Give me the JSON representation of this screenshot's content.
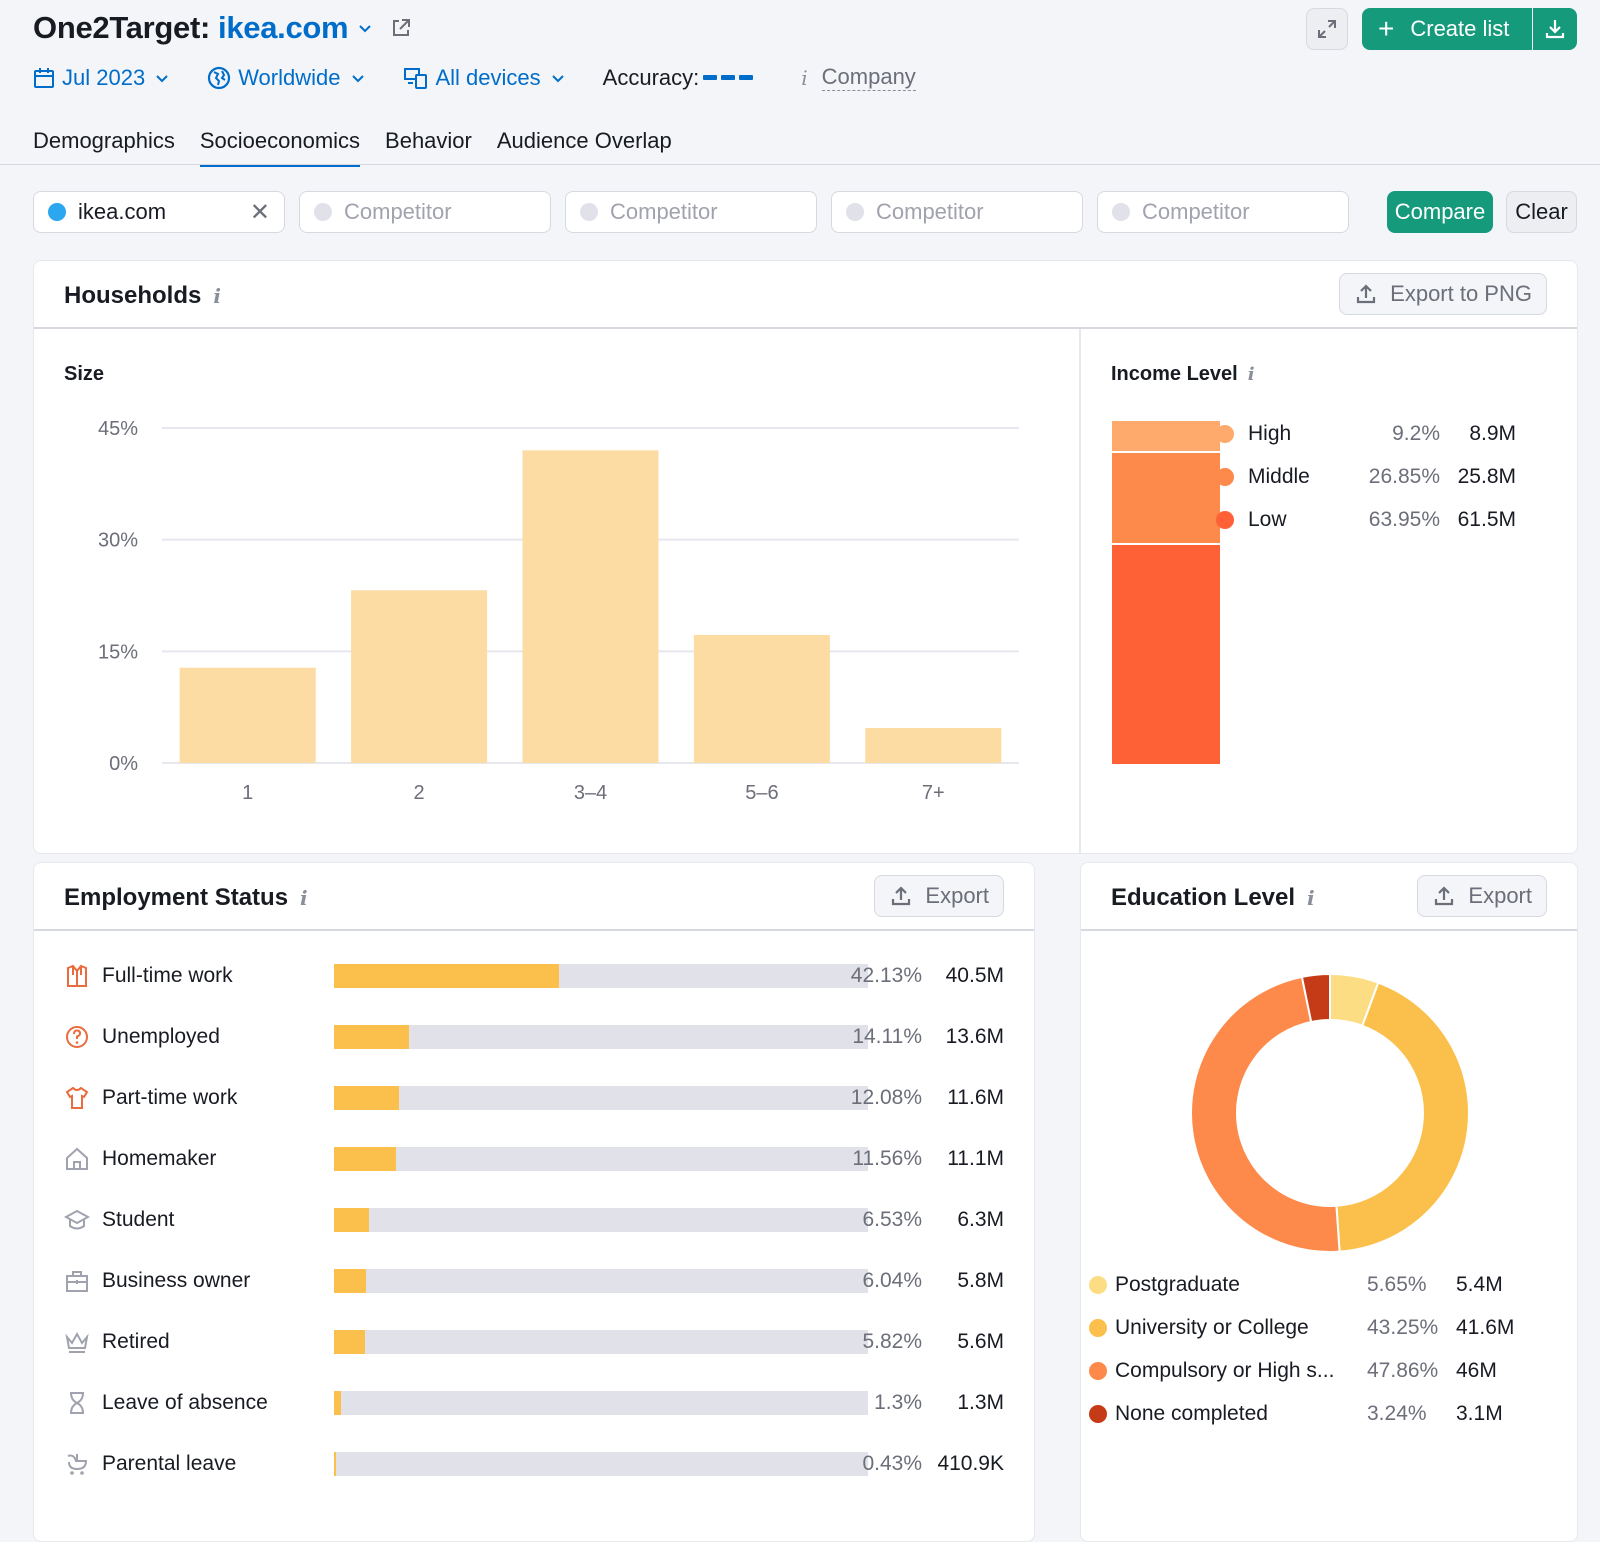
{
  "header": {
    "tool_name": "One2Target:",
    "domain": "ikea.com",
    "filters": {
      "date": "Jul 2023",
      "region": "Worldwide",
      "devices": "All devices",
      "accuracy_label": "Accuracy:",
      "company_label": "Company"
    },
    "create_list_label": "Create list"
  },
  "tabs": [
    {
      "label": "Demographics",
      "active": false
    },
    {
      "label": "Socioeconomics",
      "active": true
    },
    {
      "label": "Behavior",
      "active": false
    },
    {
      "label": "Audience Overlap",
      "active": false
    }
  ],
  "competitors": {
    "main_domain": "ikea.com",
    "placeholder": "Competitor",
    "compare_label": "Compare",
    "clear_label": "Clear"
  },
  "households": {
    "title": "Households",
    "export_label": "Export to PNG",
    "size_title": "Size",
    "income_title": "Income Level",
    "income": [
      {
        "label": "High",
        "pct": "9.2%",
        "value": "8.9M",
        "share": 9.2,
        "color": "#fdaa6c"
      },
      {
        "label": "Middle",
        "pct": "26.85%",
        "value": "25.8M",
        "share": 26.85,
        "color": "#fd8a4a"
      },
      {
        "label": "Low",
        "pct": "63.95%",
        "value": "61.5M",
        "share": 63.95,
        "color": "#ff6136"
      }
    ]
  },
  "employment": {
    "title": "Employment Status",
    "export_label": "Export",
    "rows": [
      {
        "label": "Full-time work",
        "pct": "42.13%",
        "value": "40.5M",
        "share": 42.13,
        "icon": "shirt-tie-icon"
      },
      {
        "label": "Unemployed",
        "pct": "14.11%",
        "value": "13.6M",
        "share": 14.11,
        "icon": "question-circle-icon"
      },
      {
        "label": "Part-time work",
        "pct": "12.08%",
        "value": "11.6M",
        "share": 12.08,
        "icon": "tshirt-icon"
      },
      {
        "label": "Homemaker",
        "pct": "11.56%",
        "value": "11.1M",
        "share": 11.56,
        "icon": "house-icon"
      },
      {
        "label": "Student",
        "pct": "6.53%",
        "value": "6.3M",
        "share": 6.53,
        "icon": "graduation-cap-icon"
      },
      {
        "label": "Business owner",
        "pct": "6.04%",
        "value": "5.8M",
        "share": 6.04,
        "icon": "briefcase-icon"
      },
      {
        "label": "Retired",
        "pct": "5.82%",
        "value": "5.6M",
        "share": 5.82,
        "icon": "crown-icon"
      },
      {
        "label": "Leave of absence",
        "pct": "1.3%",
        "value": "1.3M",
        "share": 1.3,
        "icon": "hourglass-icon"
      },
      {
        "label": "Parental leave",
        "pct": "0.43%",
        "value": "410.9K",
        "share": 0.43,
        "icon": "stroller-icon"
      }
    ]
  },
  "education": {
    "title": "Education Level",
    "export_label": "Export",
    "rows": [
      {
        "label": "Postgraduate",
        "pct": "5.65%",
        "value": "5.4M",
        "share": 5.65,
        "color": "#fcdd84"
      },
      {
        "label": "University or College",
        "pct": "43.25%",
        "value": "41.6M",
        "share": 43.25,
        "color": "#fbbf4b"
      },
      {
        "label": "Compulsory or High s...",
        "pct": "47.86%",
        "value": "46M",
        "share": 47.86,
        "color": "#fd8a4a"
      },
      {
        "label": "None completed",
        "pct": "3.24%",
        "value": "3.1M",
        "share": 3.24,
        "color": "#c53b17"
      }
    ]
  },
  "chart_data": [
    {
      "type": "bar",
      "title": "Size",
      "categories": [
        "1",
        "2",
        "3–4",
        "5–6",
        "7+"
      ],
      "values": [
        12.8,
        23.2,
        42.0,
        17.2,
        4.7
      ],
      "ylim": [
        0,
        45
      ],
      "yticks": [
        "0%",
        "15%",
        "30%",
        "45%"
      ],
      "ytick_values": [
        0,
        15,
        30,
        45
      ],
      "xlabel": "",
      "ylabel": "",
      "grid": true,
      "color": "#fcdca3"
    },
    {
      "type": "bar",
      "title": "Income Level",
      "stacked": true,
      "categories": [
        "High",
        "Middle",
        "Low"
      ],
      "values": [
        9.2,
        26.85,
        63.95
      ],
      "legend": "right"
    },
    {
      "type": "bar",
      "title": "Employment Status",
      "orientation": "horizontal",
      "categories": [
        "Full-time work",
        "Unemployed",
        "Part-time work",
        "Homemaker",
        "Student",
        "Business owner",
        "Retired",
        "Leave of absence",
        "Parental leave"
      ],
      "values": [
        42.13,
        14.11,
        12.08,
        11.56,
        6.53,
        6.04,
        5.82,
        1.3,
        0.43
      ],
      "xlim": [
        0,
        100
      ]
    },
    {
      "type": "pie",
      "title": "Education Level",
      "donut": true,
      "categories": [
        "Postgraduate",
        "University or College",
        "Compulsory or High s...",
        "None completed"
      ],
      "values": [
        5.65,
        43.25,
        47.86,
        3.24
      ],
      "legend": "bottom"
    }
  ]
}
